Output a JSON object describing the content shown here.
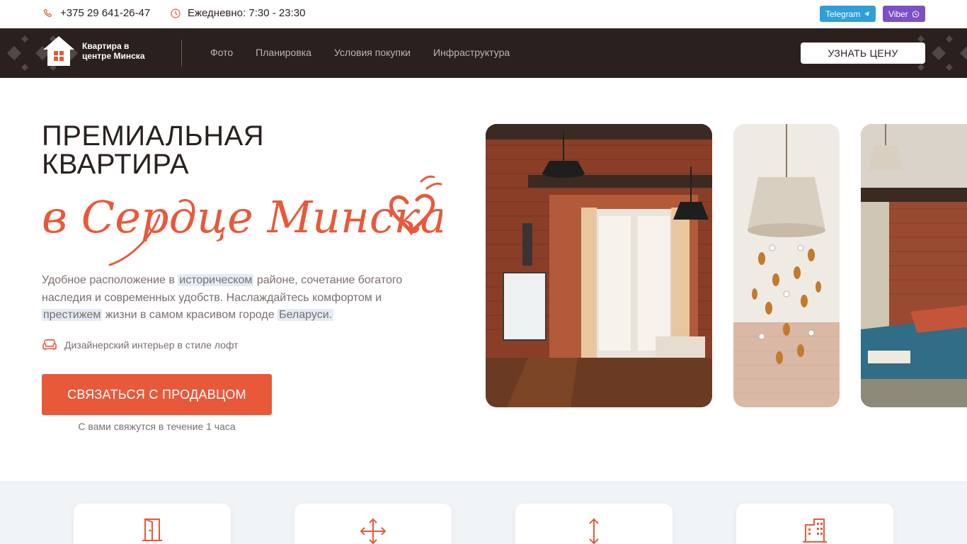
{
  "topbar": {
    "phone": "+375 29 641-26-47",
    "hours": "Ежедневно: 7:30 - 23:30",
    "telegram_label": "Telegram",
    "viber_label": "Viber",
    "accent_color": "#e8593a"
  },
  "nav": {
    "logo_text": "Квартира в центре Минска",
    "links": [
      "Фото",
      "Планировка",
      "Условия покупки",
      "Инфраструктура"
    ],
    "price_button": "УЗНАТЬ ЦЕНУ"
  },
  "hero": {
    "title_line1": "ПРЕМИАЛЬНАЯ",
    "title_line2": "КВАРТИРА",
    "script_text": "в Сердце Минска",
    "desc_1": "Удобное расположение в ",
    "desc_hl1": "историческом",
    "desc_2": " районе, сочетание богатого наследия и современных удобств. Наслаждайтесь комфортом и ",
    "desc_hl2": "престижем",
    "desc_3": " жизни в самом красивом городе ",
    "desc_hl3": "Беларуси.",
    "feature": "Дизайнерский интерьер в стиле лофт",
    "cta_label": "СВЯЗАТЬСЯ С ПРОДАВЦОМ",
    "cta_note": "С вами свяжутся в течение 1 часа"
  },
  "photos": [
    {
      "name": "loft-living-room-photo"
    },
    {
      "name": "crystal-chandelier-photo"
    },
    {
      "name": "bedroom-photo"
    }
  ],
  "cards": [
    {
      "icon": "door-icon"
    },
    {
      "icon": "expand-arrows-icon"
    },
    {
      "icon": "vertical-arrow-icon"
    },
    {
      "icon": "building-icon"
    }
  ],
  "colors": {
    "accent": "#e8593a",
    "navbar": "#2a201e",
    "telegram": "#2f9fd8",
    "viber": "#7d4fc4",
    "highlight": "#e3ebf6"
  }
}
